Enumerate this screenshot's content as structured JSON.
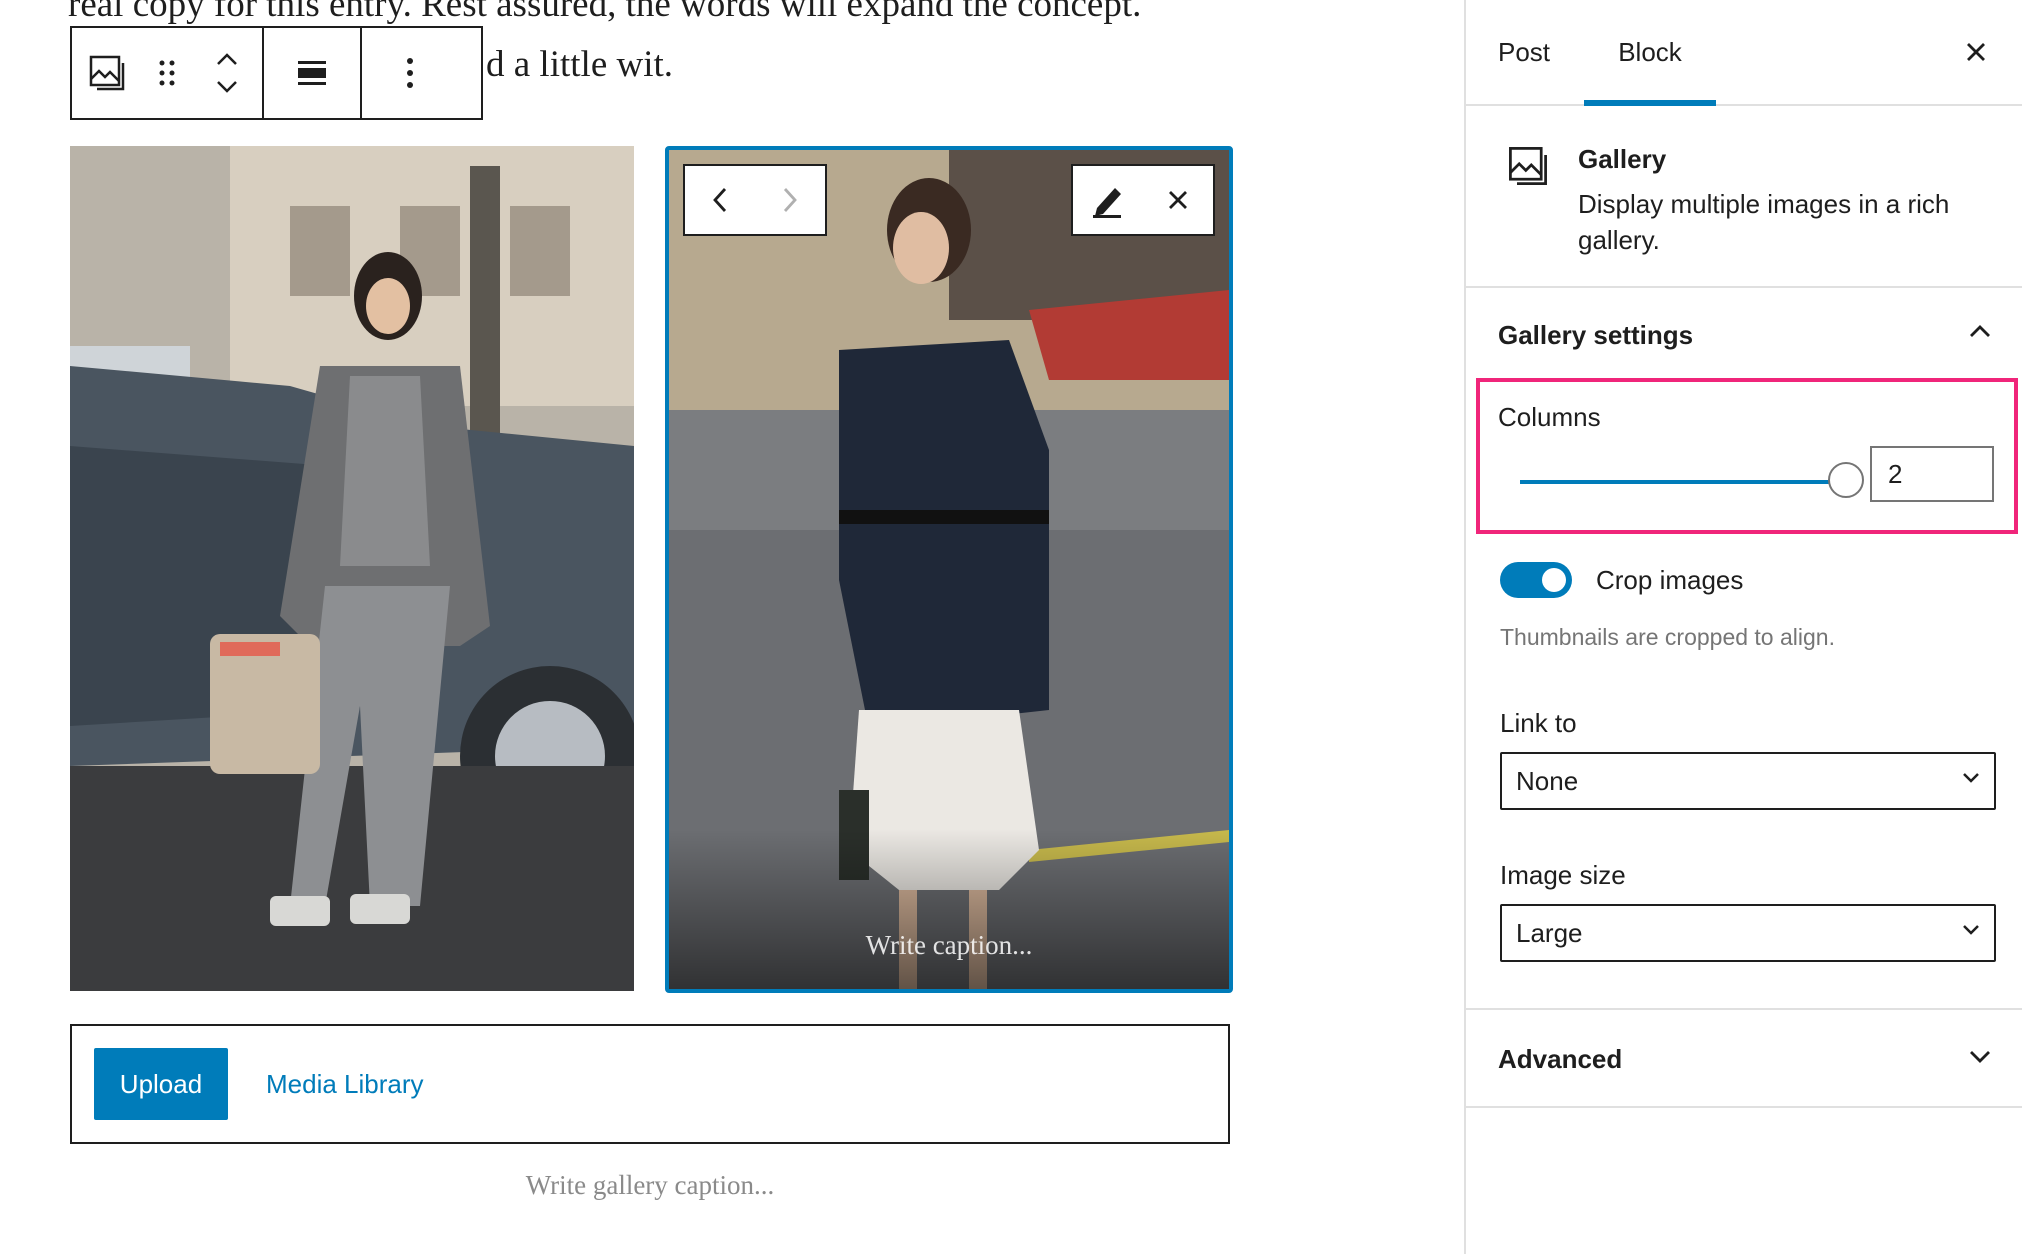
{
  "editor": {
    "paragraph_line1": "real copy for this entry. Rest assured, the words will expand the concept.",
    "paragraph_line2": "d a little wit.",
    "toolbar": {
      "icons": [
        "gallery-icon",
        "drag-handle-icon",
        "move-up-icon",
        "move-down-icon",
        "align-icon",
        "more-options-icon"
      ]
    },
    "image_caption_placeholder": "Write caption...",
    "upload_label": "Upload",
    "media_library_label": "Media Library",
    "gallery_caption_placeholder": "Write gallery caption..."
  },
  "sidebar": {
    "tabs": [
      {
        "label": "Post",
        "active": false
      },
      {
        "label": "Block",
        "active": true
      }
    ],
    "block": {
      "title": "Gallery",
      "description": "Display multiple images in a rich gallery."
    },
    "gallery_settings": {
      "title": "Gallery settings",
      "columns_label": "Columns",
      "columns_value": "2",
      "columns_slider_fraction": 1.0,
      "crop_label": "Crop images",
      "crop_enabled": true,
      "crop_help": "Thumbnails are cropped to align.",
      "link_to_label": "Link to",
      "link_to_value": "None",
      "image_size_label": "Image size",
      "image_size_value": "Large"
    },
    "advanced_title": "Advanced"
  },
  "colors": {
    "accent": "#007cba",
    "highlight": "#f0257a",
    "text": "#1e1e1e",
    "muted": "#757575"
  }
}
